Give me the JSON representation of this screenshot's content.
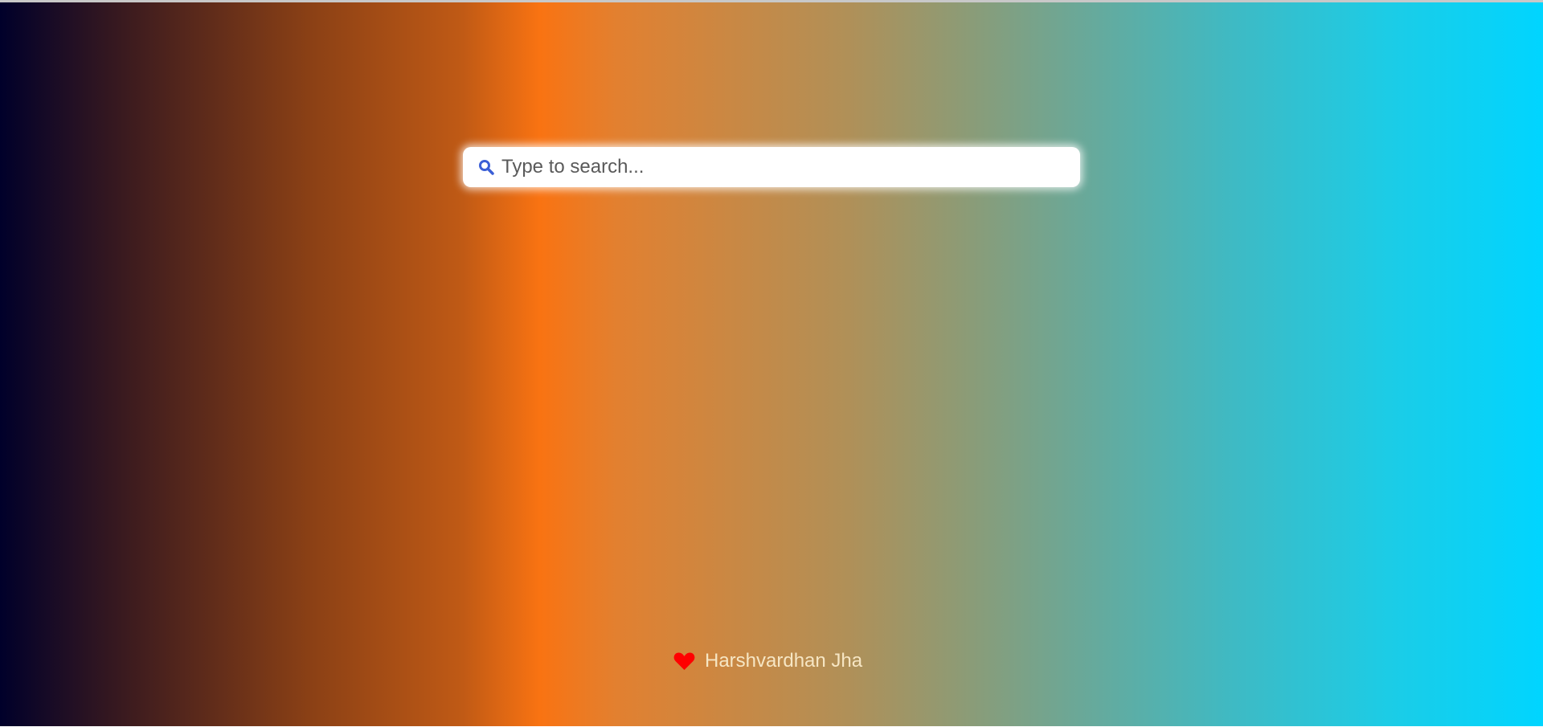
{
  "search": {
    "placeholder": "Type to search...",
    "value": "",
    "icon": "search-icon"
  },
  "footer": {
    "icon": "heart-icon",
    "author": "Harshvardhan Jha"
  },
  "colors": {
    "gradient_start": "#00002a",
    "gradient_mid": "#f97312",
    "gradient_end": "#00d5ff",
    "search_icon": "#3b5fd6",
    "heart": "#ff0000",
    "author_text": "#f6e6c4"
  }
}
